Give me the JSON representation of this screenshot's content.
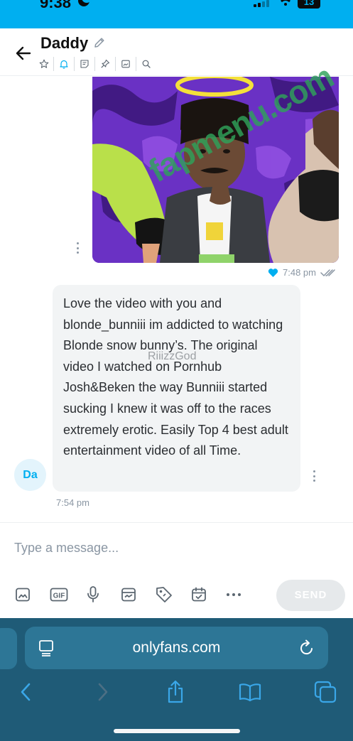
{
  "status_bar": {
    "time": "9:38",
    "battery": "13"
  },
  "header": {
    "title": "Daddy"
  },
  "messages": {
    "sent_time": "7:48 pm",
    "received_text": "Love the video with you and blonde_bunniii im addicted to watching Blonde snow bunny’s. The original video I watched on Pornhub Josh&Beken the way Bunniii started sucking I knew it was off to the races extremely erotic. Easily Top 4 best adult entertainment video of all Time.",
    "received_overlay_name": "RiiizzGod",
    "avatar_initials": "Da",
    "received_time": "7:54 pm"
  },
  "composer": {
    "placeholder": "Type a message...",
    "send_label": "SEND",
    "tool_icons": [
      "image-icon",
      "gif-icon",
      "microphone-icon",
      "vault-icon",
      "price-tag-icon",
      "schedule-icon",
      "more-icon"
    ]
  },
  "browser": {
    "url": "onlyfans.com"
  },
  "watermark": {
    "text": "fapmenu.com"
  },
  "colors": {
    "accent": "#00aff0",
    "browser_bar": "#1f5b77",
    "bubble": "#f2f4f5",
    "muted": "#8a96a3"
  }
}
